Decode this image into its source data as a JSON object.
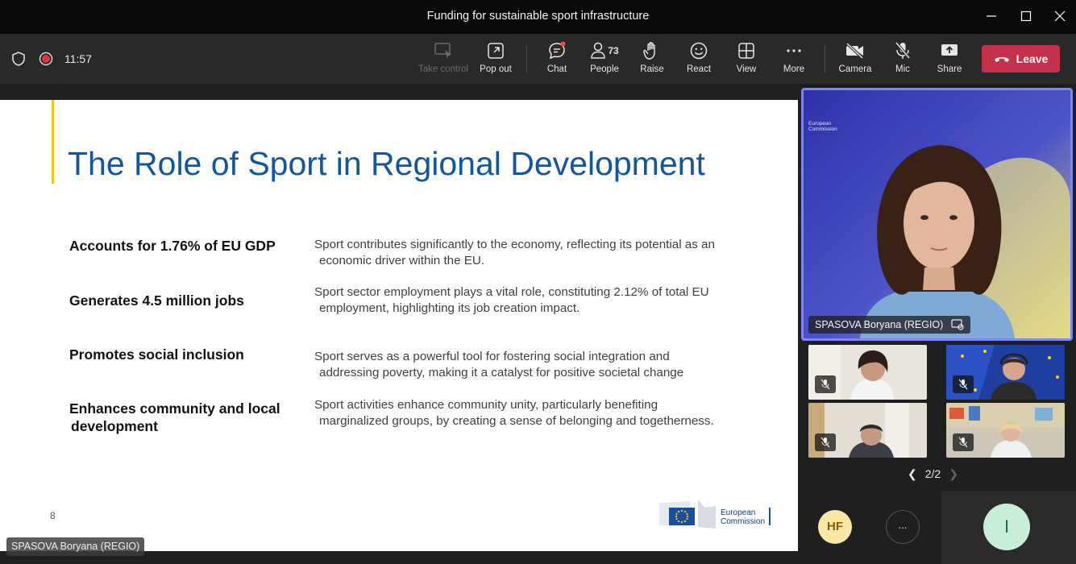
{
  "window": {
    "title": "Funding for sustainable sport infrastructure"
  },
  "toolbar": {
    "timer": "11:57",
    "buttons": {
      "take_control": "Take control",
      "pop_out": "Pop out",
      "chat": "Chat",
      "people": "People",
      "people_count": "73",
      "raise": "Raise",
      "react": "React",
      "view": "View",
      "more": "More",
      "camera": "Camera",
      "mic": "Mic",
      "share": "Share",
      "leave": "Leave"
    },
    "colors": {
      "leave": "#c4314b",
      "accent": "#7f85f5"
    }
  },
  "slide": {
    "title": "The Role of Sport in Regional Development",
    "rows": [
      {
        "point": "Accounts for 1.76% of EU GDP",
        "point2": "",
        "desc1": "Sport contributes significantly to the economy, reflecting its potential as an",
        "desc2": "economic driver within the EU."
      },
      {
        "point": "Generates 4.5 million jobs",
        "point2": "",
        "desc1": "Sport sector employment plays a vital role, constituting 2.12% of total EU",
        "desc2": "employment, highlighting its job creation impact."
      },
      {
        "point": "Promotes social inclusion",
        "point2": "",
        "desc1": "Sport serves as a powerful tool for fostering social integration and",
        "desc2": "addressing poverty, making it a catalyst for positive societal change"
      },
      {
        "point": "Enhances community and local",
        "point2": "development",
        "desc1": "Sport activities enhance community unity, particularly benefiting",
        "desc2": "marginalized groups, by creating a sense of belonging and togetherness."
      }
    ],
    "page_number": "8",
    "logo_line1": "European",
    "logo_line2": "Commission"
  },
  "presenter_tag": "SPASOVA Boryana (REGIO)",
  "main_video": {
    "name": "SPASOVA Boryana (REGIO)",
    "backdrop_line1": "European",
    "backdrop_line2": "Commission"
  },
  "gallery": {
    "page": "2/2"
  },
  "participants": {
    "hf": "HF",
    "more": "...",
    "i": "I"
  }
}
